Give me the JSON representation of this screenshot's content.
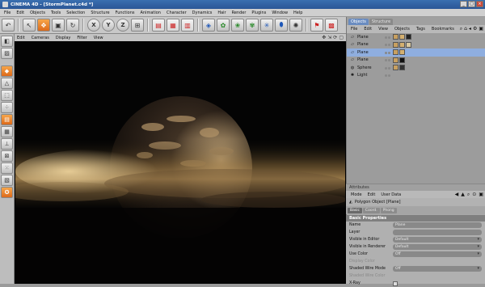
{
  "window": {
    "title": "CINEMA 4D - [StormPlanet.c4d *]"
  },
  "menubar": [
    "File",
    "Edit",
    "Objects",
    "Tools",
    "Selection",
    "Structure",
    "Functions",
    "Animation",
    "Character",
    "Dynamics",
    "Hair",
    "Render",
    "Plugins",
    "Window",
    "Help"
  ],
  "viewport_menu": [
    "Edit",
    "Cameras",
    "Display",
    "Filter",
    "View"
  ],
  "object_manager": {
    "tabs": [
      "Objects",
      "Structure"
    ],
    "menu": [
      "File",
      "Edit",
      "View",
      "Objects",
      "Tags",
      "Bookmarks"
    ],
    "objects": [
      {
        "name": "Plane",
        "icon": "plane-icon"
      },
      {
        "name": "Plane",
        "icon": "plane-icon"
      },
      {
        "name": "Plane",
        "icon": "plane-icon"
      },
      {
        "name": "Plane",
        "icon": "plane-icon"
      },
      {
        "name": "Sphere",
        "icon": "sphere-icon"
      },
      {
        "name": "Light",
        "icon": "light-icon"
      }
    ]
  },
  "attributes": {
    "header": "Attributes",
    "menu": [
      "Mode",
      "Edit",
      "User Data"
    ],
    "object_title": "Polygon Object [Plane]",
    "tabs": [
      "Basic",
      "Coord.",
      "Phong"
    ],
    "section": "Basic Properties",
    "props": [
      {
        "label": "Name",
        "value": "Plane",
        "type": "text",
        "dim": false
      },
      {
        "label": "Layer",
        "value": "",
        "type": "text",
        "dim": false
      },
      {
        "label": "Visible in Editor",
        "value": "Default",
        "type": "dropdown",
        "dim": false
      },
      {
        "label": "Visible in Renderer",
        "value": "Default",
        "type": "dropdown",
        "dim": false
      },
      {
        "label": "Use Color",
        "value": "Off",
        "type": "dropdown",
        "dim": false
      },
      {
        "label": "Display Color",
        "value": "",
        "type": "none",
        "dim": true
      },
      {
        "label": "Shaded Wire Mode",
        "value": "Off",
        "type": "dropdown",
        "dim": false
      },
      {
        "label": "Shaded Wire Color",
        "value": "",
        "type": "none",
        "dim": true
      },
      {
        "label": "X-Ray",
        "value": "",
        "type": "checkbox",
        "dim": false
      }
    ]
  },
  "toolbar_icons": [
    "undo-icon",
    "live-select-icon",
    "move-icon",
    "scale-icon",
    "rotate-icon",
    "x-axis-icon",
    "y-axis-icon",
    "z-axis-icon",
    "world-coords-icon",
    "render-view-icon",
    "render-picture-icon",
    "render-settings-icon",
    "cube-icon",
    "nurbs-icon",
    "spline-icon",
    "array-icon",
    "deformer-icon",
    "scene-icon",
    "light-icon",
    "render-queue-icon",
    "close-panel-icon"
  ]
}
